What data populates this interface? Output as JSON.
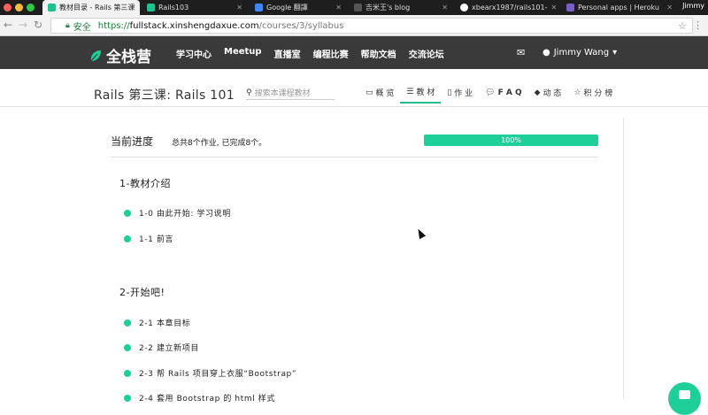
{
  "browser": {
    "tabs": [
      {
        "title": "教材目录 - Rails 第三课",
        "favicon_color": "#1fbf8f",
        "active": true
      },
      {
        "title": "Rails103",
        "favicon_color": "#1fbf8f",
        "active": false
      },
      {
        "title": "Google 翻譯",
        "favicon_color": "#4285f4",
        "active": false
      },
      {
        "title": "吉米王's blog",
        "favicon_color": "#555555",
        "active": false
      },
      {
        "title": "xbearx1987/rails101-",
        "favicon_color": "#ffffff",
        "active": false
      },
      {
        "title": "Personal apps | Heroku",
        "favicon_color": "#7b5fc4",
        "active": false
      }
    ],
    "profile_name": "Jimmy",
    "secure_label": "安全",
    "url_scheme": "https://",
    "url_host": "fullstack.xinshengdaxue.com",
    "url_path": "/courses/3/syllabus"
  },
  "site": {
    "logo_text": "全栈营",
    "nav": [
      "学习中心",
      "Meetup",
      "直播室",
      "编程比赛",
      "帮助文档",
      "交流论坛"
    ],
    "user_name": "Jimmy Wang",
    "accent_color": "#1fcf9a"
  },
  "course": {
    "title": "Rails 第三课: Rails 101",
    "search_placeholder": "搜索本课程教材",
    "tabs": [
      {
        "label": "概 览",
        "icon": "monitor-icon"
      },
      {
        "label": "教 材",
        "icon": "list-icon",
        "active": true
      },
      {
        "label": "作 业",
        "icon": "file-icon"
      },
      {
        "label": "F A Q",
        "icon": "chat-icon"
      },
      {
        "label": "动 态",
        "icon": "tags-icon"
      },
      {
        "label": "积 分 榜",
        "icon": "star-icon"
      }
    ]
  },
  "progress": {
    "label": "当前进度",
    "note": "总共8个作业, 已完成8个。",
    "percent": 100,
    "percent_text": "100%"
  },
  "sections": [
    {
      "title": "1-教材介绍",
      "lessons": [
        "1-0 由此开始: 学习说明",
        "1-1 前言"
      ]
    },
    {
      "title": "2-开始吧!",
      "lessons": [
        "2-1 本章目标",
        "2-2 建立新项目",
        "2-3 帮 Rails 项目穿上衣服“Bootstrap”",
        "2-4 套用 Bootstrap 的 html 样式"
      ]
    }
  ]
}
